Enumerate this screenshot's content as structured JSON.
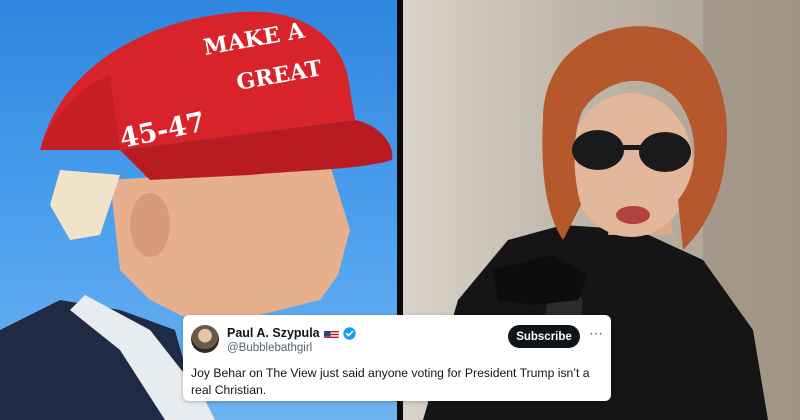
{
  "left_photo": {
    "hat_lines": [
      "MAKE A",
      "GREAT"
    ],
    "hat_number": "45-47",
    "colors": {
      "sky": "#4ea1ee",
      "hat": "#d8232a"
    }
  },
  "right_photo": {
    "colors": {
      "background": "#bfb6a9",
      "hair": "#b5582b",
      "coat": "#151515"
    }
  },
  "tweet": {
    "author_name": "Paul A. Szypula",
    "author_flag_icon": "us-flag-icon",
    "verified_icon": "verified-badge-icon",
    "handle": "@Bubblebathgirl",
    "subscribe_label": "Subscribe",
    "more_icon": "⋯",
    "text": "Joy Behar on The View just said anyone voting for President Trump isn’t a real Christian.",
    "colors": {
      "verified": "#1d9bf0",
      "button": "#0f1419"
    }
  }
}
